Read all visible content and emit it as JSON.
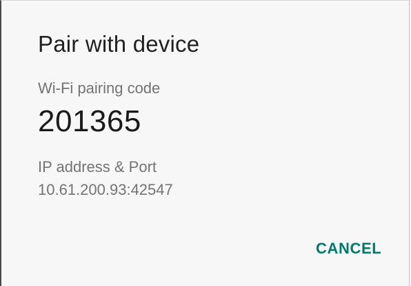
{
  "dialog": {
    "title": "Pair with device",
    "pairing_code_label": "Wi-Fi pairing code",
    "pairing_code": "201365",
    "address_label": "IP address & Port",
    "address": "10.61.200.93:42547",
    "cancel_label": "CANCEL"
  },
  "colors": {
    "accent": "#00796b",
    "title_text": "#212121",
    "secondary_text": "#737373",
    "background": "#f7f7f7"
  }
}
